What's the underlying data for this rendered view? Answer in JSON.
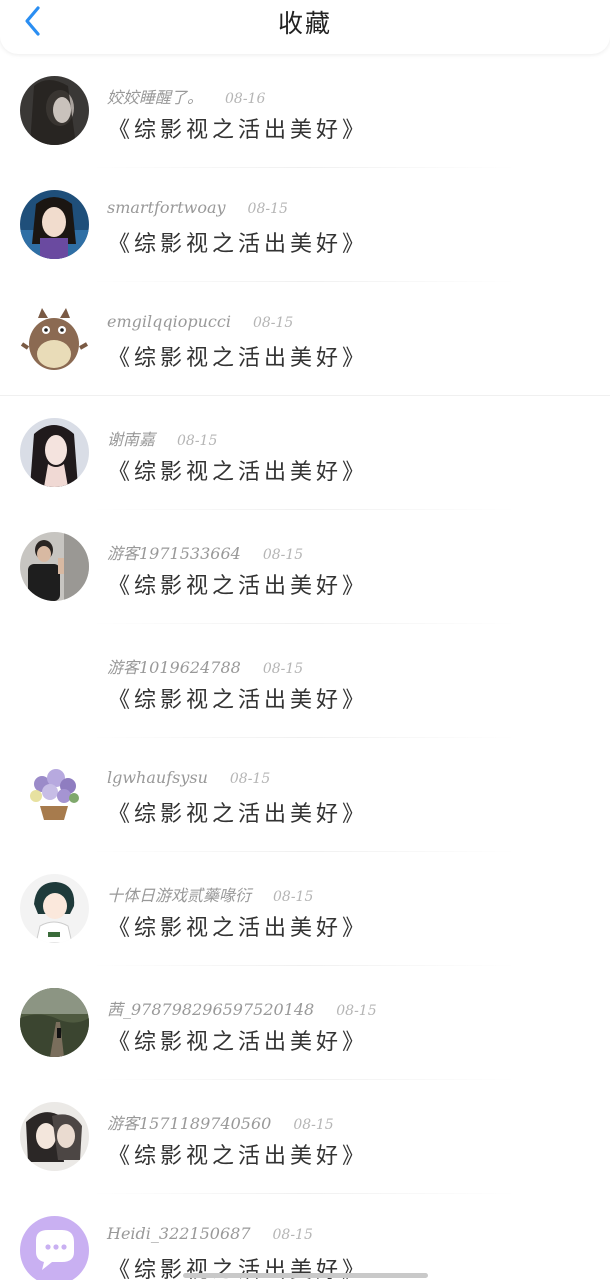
{
  "header": {
    "title": "收藏",
    "back_icon": "chevron-left-icon",
    "accent_color": "#2a8ef2"
  },
  "items": [
    {
      "user": "姣姣睡醒了。",
      "date": "08-16",
      "book": "《综影视之活出美好》",
      "avatar": "dark-portrait"
    },
    {
      "user": "smartfortwoay",
      "date": "08-15",
      "book": "《综影视之活出美好》",
      "avatar": "girl-portrait"
    },
    {
      "user": "emgilqqiopucci",
      "date": "08-15",
      "book": "《综影视之活出美好》",
      "avatar": "totoro"
    },
    {
      "user": "谢南嘉",
      "date": "08-15",
      "book": "《综影视之活出美好》",
      "avatar": "woman-portrait"
    },
    {
      "user": "游客1971533664",
      "date": "08-15",
      "book": "《综影视之活出美好》",
      "avatar": "man-portrait"
    },
    {
      "user": "游客1019624788",
      "date": "08-15",
      "book": "《综影视之活出美好》",
      "avatar": "blank"
    },
    {
      "user": "lgwhaufsysu",
      "date": "08-15",
      "book": "《综影视之活出美好》",
      "avatar": "flower-basket"
    },
    {
      "user": "十体日游戏贰藥喙衍",
      "date": "08-15",
      "book": "《综影视之活出美好》",
      "avatar": "cartoon-girl"
    },
    {
      "user": "茜_978798296597520148",
      "date": "08-15",
      "book": "《综影视之活出美好》",
      "avatar": "landscape"
    },
    {
      "user": "游客1571189740560",
      "date": "08-15",
      "book": "《综影视之活出美好》",
      "avatar": "anime-couple"
    },
    {
      "user": "Heidi_322150687",
      "date": "08-15",
      "book": "《综影视之活出美好》",
      "avatar": "default-chat"
    }
  ]
}
